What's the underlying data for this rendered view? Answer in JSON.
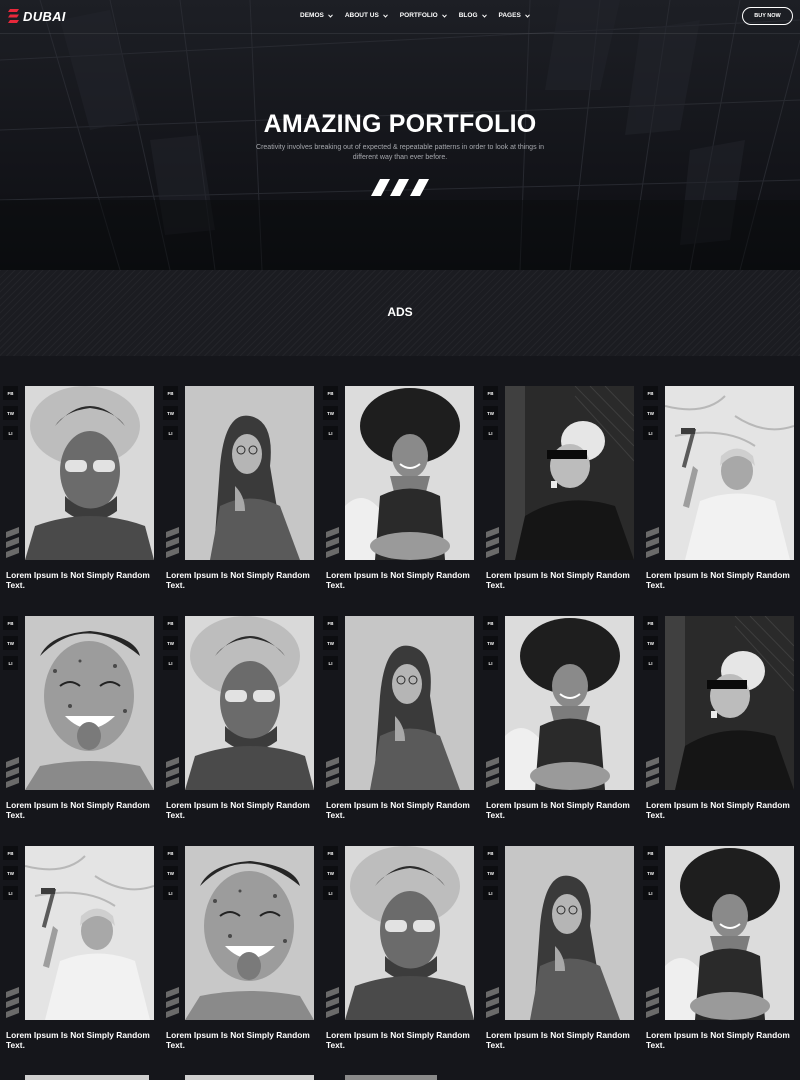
{
  "brand": {
    "name": "DUBAI",
    "accent": "#e8283b"
  },
  "nav": {
    "items": [
      {
        "label": "DEMOS"
      },
      {
        "label": "ABOUT US"
      },
      {
        "label": "PORTFOLIO"
      },
      {
        "label": "BLOG"
      },
      {
        "label": "PAGES"
      }
    ],
    "cta": "BUY NOW"
  },
  "hero": {
    "title": "AMAZING PORTFOLIO",
    "subtitle": "Creativity involves breaking out of expected & repeatable patterns in order to look at things in different way than ever before."
  },
  "section": {
    "title": "ADS"
  },
  "social_labels": [
    "FB",
    "TW",
    "LI"
  ],
  "portfolio": {
    "items": [
      {
        "title": "Lorem Ipsum Is Not Simply Random Text.",
        "photo": "man-sunglasses-smoke"
      },
      {
        "title": "Lorem Ipsum Is Not Simply Random Text.",
        "photo": "woman-long-hair-glasses"
      },
      {
        "title": "Lorem Ipsum Is Not Simply Random Text.",
        "photo": "woman-curly-hair-smiling"
      },
      {
        "title": "Lorem Ipsum Is Not Simply Random Text.",
        "photo": "person-visor-leather-jacket"
      },
      {
        "title": "Lorem Ipsum Is Not Simply Random Text.",
        "photo": "woman-hammer-raised"
      },
      {
        "title": "Lorem Ipsum Is Not Simply Random Text.",
        "photo": "man-tongue-out-paint"
      },
      {
        "title": "Lorem Ipsum Is Not Simply Random Text.",
        "photo": "man-sunglasses-smoke"
      },
      {
        "title": "Lorem Ipsum Is Not Simply Random Text.",
        "photo": "woman-long-hair-glasses"
      },
      {
        "title": "Lorem Ipsum Is Not Simply Random Text.",
        "photo": "woman-curly-hair-smiling"
      },
      {
        "title": "Lorem Ipsum Is Not Simply Random Text.",
        "photo": "person-visor-leather-jacket"
      },
      {
        "title": "Lorem Ipsum Is Not Simply Random Text.",
        "photo": "woman-hammer-raised"
      },
      {
        "title": "Lorem Ipsum Is Not Simply Random Text.",
        "photo": "man-tongue-out-paint"
      },
      {
        "title": "Lorem Ipsum Is Not Simply Random Text.",
        "photo": "man-sunglasses-smoke"
      },
      {
        "title": "Lorem Ipsum Is Not Simply Random Text.",
        "photo": "woman-long-hair-glasses"
      },
      {
        "title": "Lorem Ipsum Is Not Simply Random Text.",
        "photo": "woman-curly-hair-smiling"
      }
    ]
  }
}
